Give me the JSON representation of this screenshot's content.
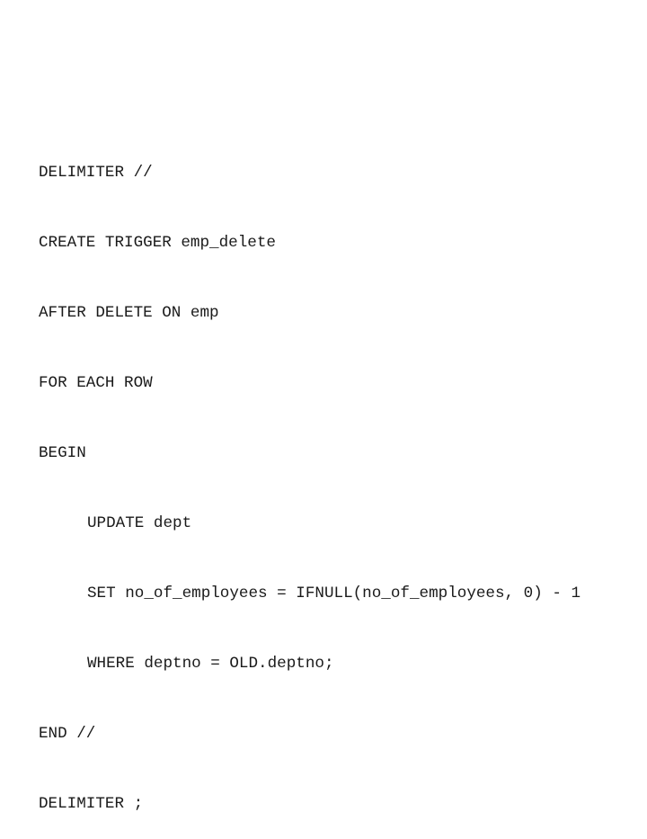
{
  "code": {
    "language": "sql",
    "lines": [
      {
        "text": "DELIMITER //",
        "indent": 0
      },
      {
        "text": "CREATE TRIGGER emp_delete",
        "indent": 0
      },
      {
        "text": "AFTER DELETE ON emp",
        "indent": 0
      },
      {
        "text": "FOR EACH ROW",
        "indent": 0
      },
      {
        "text": "BEGIN",
        "indent": 0
      },
      {
        "text": "UPDATE dept",
        "indent": 1
      },
      {
        "text": "SET no_of_employees = IFNULL(no_of_employees, 0) - 1",
        "indent": 1
      },
      {
        "text": "WHERE deptno = OLD.deptno;",
        "indent": 1
      },
      {
        "text": "END //",
        "indent": 0
      },
      {
        "text": "DELIMITER ;",
        "indent": 0
      }
    ]
  }
}
